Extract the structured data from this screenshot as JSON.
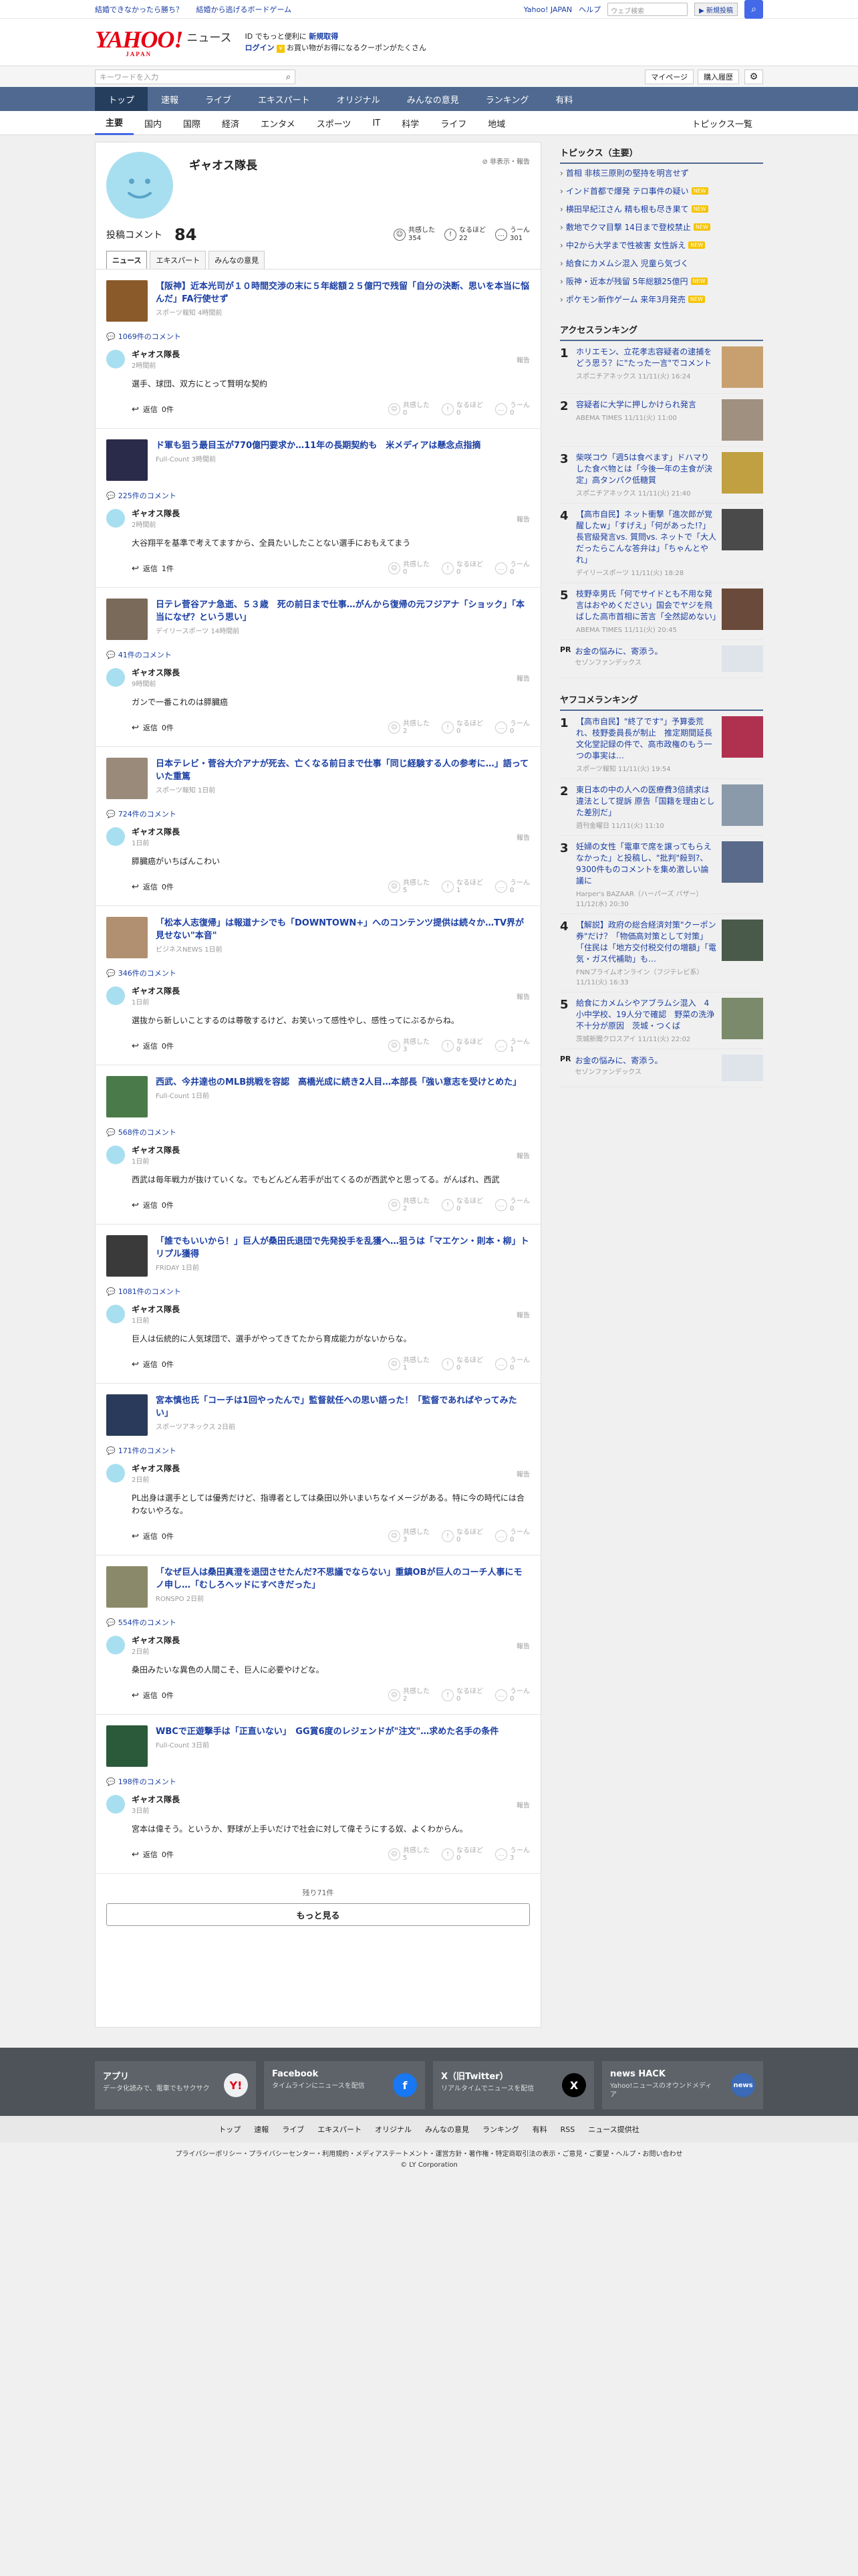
{
  "top_links": [
    "結婚できなかったら勝ち？",
    "結婚から逃げるボードゲーム"
  ],
  "top_right": {
    "yahoo": "Yahoo! JAPAN",
    "help": "ヘルプ",
    "search_placeholder": "ウェブ検索",
    "search_btn": "▶ 新規投稿"
  },
  "logo": {
    "main": "YAHOO!",
    "sub": "JAPAN",
    "news": "ニュース"
  },
  "promo": {
    "line1a": "ID でもっと便利に",
    "line1b": "新規取得",
    "line2a": "ログイン",
    "line2b": "お買い物がお得になるクーポンがたくさん"
  },
  "search": {
    "placeholder": "キーワードを入力",
    "mypage": "マイページ",
    "history": "購入履歴"
  },
  "mainnav": [
    "トップ",
    "速報",
    "ライブ",
    "エキスパート",
    "オリジナル",
    "みんなの意見",
    "ランキング",
    "有料"
  ],
  "subnav": [
    "主要",
    "国内",
    "国際",
    "経済",
    "エンタメ",
    "スポーツ",
    "IT",
    "科学",
    "ライフ",
    "地域"
  ],
  "subnav_all": "トピックス一覧",
  "profile": {
    "name": "ギャオス隊長",
    "hide": "非表示・報告",
    "posts_label": "投稿コメント",
    "posts_count": "84",
    "reactions": [
      {
        "label": "共感した",
        "count": "354"
      },
      {
        "label": "なるほど",
        "count": "22"
      },
      {
        "label": "うーん",
        "count": "301"
      }
    ]
  },
  "tabs": [
    "ニュース",
    "エキスパート",
    "みんなの意見"
  ],
  "reply_label": "返信",
  "vote_labels": [
    "共感した",
    "なるほど",
    "うーん"
  ],
  "report_label": "報告",
  "entries": [
    {
      "title": "【阪神】近本光司が１０時間交渉の末に５年総額２５億円で残留「自分の決断、思いを本当に悩んだ」FA行使せず",
      "source": "スポーツ報知 4時間前",
      "comments": "1069件のコメント",
      "time": "2時間前",
      "text": "選手、球団、双方にとって賢明な契約",
      "replies": "0件",
      "votes": [
        "0",
        "0",
        "0"
      ],
      "thumb": "#8a5a2a"
    },
    {
      "title": "ド軍も狙う最目玉が770億円要求か…11年の長期契約も　米メディアは懸念点指摘",
      "source": "Full-Count 3時間前",
      "comments": "225件のコメント",
      "time": "2時間前",
      "text": "大谷翔平を基準で考えてますから、全員たいしたことない選手におもえてまう",
      "replies": "1件",
      "votes": [
        "0",
        "0",
        "0"
      ],
      "thumb": "#2a2a4a"
    },
    {
      "title": "日テレ菅谷アナ急逝、５３歳　死の前日まで仕事…がんから復帰の元フジアナ「ショック」「本当になぜ？という思い」",
      "source": "デイリースポーツ 14時間前",
      "comments": "41件のコメント",
      "time": "9時間前",
      "text": "ガンで一番これのは膵臓癌",
      "replies": "0件",
      "votes": [
        "2",
        "0",
        "0"
      ],
      "thumb": "#7a6a5a"
    },
    {
      "title": "日本テレビ・菅谷大介アナが死去、亡くなる前日まで仕事「同じ経験する人の参考に…」語っていた重篤",
      "source": "スポーツ報知 1日前",
      "comments": "724件のコメント",
      "time": "1日前",
      "text": "膵臓癌がいちばんこわい",
      "replies": "0件",
      "votes": [
        "5",
        "1",
        "0"
      ],
      "thumb": "#9a8a7a"
    },
    {
      "title": "「松本人志復帰」は報道ナシでも「DOWNTOWN+」へのコンテンツ提供は続々か…TV界が見せない\"本音\"",
      "source": "ビジネスNEWS 1日前",
      "comments": "346件のコメント",
      "time": "1日前",
      "text": "選抜から新しいことするのは尊敬するけど、お笑いって感性やし、感性ってにぶるからね。",
      "replies": "0件",
      "votes": [
        "3",
        "0",
        "1"
      ],
      "thumb": "#b09070"
    },
    {
      "title": "西武、今井達也のMLB挑戦を容認　高橋光成に続き2人目…本部長「強い意志を受けとめた」",
      "source": "Full-Count 1日前",
      "comments": "568件のコメント",
      "time": "1日前",
      "text": "西武は毎年戦力が抜けていくな。でもどんどん若手が出てくるのが西武やと思ってる。がんばれ、西武",
      "replies": "0件",
      "votes": [
        "2",
        "0",
        "0"
      ],
      "thumb": "#4a7a4a"
    },
    {
      "title": "「誰でもいいから！」巨人が桑田氏退団で先発投手を乱獲へ…狙うは「マエケン・則本・柳」トリプル獲得",
      "source": "FRIDAY 1日前",
      "comments": "1081件のコメント",
      "time": "1日前",
      "text": "巨人は伝統的に人気球団で、選手がやってきてたから育成能力がないからな。",
      "replies": "0件",
      "votes": [
        "1",
        "0",
        "0"
      ],
      "thumb": "#3a3a3a"
    },
    {
      "title": "宮本慎也氏「コーチは1回やったんで」監督就任への思い語った！「監督であればやってみたい」",
      "source": "スポーツアネックス 2日前",
      "comments": "171件のコメント",
      "time": "2日前",
      "text": "PL出身は選手としては優秀だけど、指導者としては桑田以外いまいちなイメージがある。特に今の時代には合わないやろな。",
      "replies": "0件",
      "votes": [
        "3",
        "0",
        "0"
      ],
      "thumb": "#2a3a5a"
    },
    {
      "title": "「なぜ巨人は桑田真澄を退団させたんだ?不思議でならない」重鎮OBが巨人のコーチ人事にモノ申し…「むしろヘッドにすべきだった」",
      "source": "RONSPO 2日前",
      "comments": "554件のコメント",
      "time": "2日前",
      "text": "桑田みたいな異色の人間こそ、巨人に必要やけどな。",
      "replies": "0件",
      "votes": [
        "2",
        "0",
        "0"
      ],
      "thumb": "#8a8a6a"
    },
    {
      "title": "WBCで正遊撃手は「正直いない」　GG賞6度のレジェンドが\"注文\"…求めた名手の条件",
      "source": "Full-Count 3日前",
      "comments": "198件のコメント",
      "time": "3日前",
      "text": "宮本は偉そう。というか、野球が上手いだけで社会に対して偉そうにする奴、よくわからん。",
      "replies": "0件",
      "votes": [
        "5",
        "0",
        "3"
      ],
      "thumb": "#2a5a3a"
    }
  ],
  "more": {
    "remain": "残り71件",
    "button": "もっと見る"
  },
  "side": {
    "topics_head": "トピックス（主要）",
    "topics": [
      {
        "t": "首相 非核三原則の堅持を明言せず",
        "n": false
      },
      {
        "t": "インド首都で爆発 テロ事件の疑い",
        "n": true
      },
      {
        "t": "横田早紀江さん 精も根も尽き果て",
        "n": true
      },
      {
        "t": "敷地でクマ目撃 14日まで登校禁止",
        "n": true
      },
      {
        "t": "中2から大学まで性被害 女性訴え",
        "n": true
      },
      {
        "t": "給食にカメムシ混入 児童ら気づく",
        "n": false
      },
      {
        "t": "阪神・近本が残留 5年総額25億円",
        "n": true
      },
      {
        "t": "ポケモン新作ゲーム 来年3月発売",
        "n": true
      }
    ],
    "access_head": "アクセスランキング",
    "access": [
      {
        "n": "1",
        "t": "ホリエモン、立花孝志容疑者の逮捕をどう思う？に\"たった一言\"でコメント",
        "s": "スポニチアネックス 11/11(火) 16:24",
        "c": "#c8a070"
      },
      {
        "n": "2",
        "t": "容疑者に大学に押しかけられ発言",
        "s": "ABEMA TIMES 11/11(火) 11:00",
        "c": "#a09080"
      },
      {
        "n": "3",
        "t": "柴咲コウ「週5は食べます」ドハマりした食べ物とは「今後一年の主食が決定」高タンパク低糖質",
        "s": "スポニチアネックス 11/11(火) 21:40",
        "c": "#c0a040"
      },
      {
        "n": "4",
        "t": "【高市自民】ネット衝撃「進次郎が覚醒したw」「すげえ」「何があった!?」長官級発言vs. 質問vs. ネットで「大人だったらこんな答弁は」「ちゃんとやれ」",
        "s": "デイリースポーツ 11/11(火) 18:28",
        "c": "#4a4a4a"
      },
      {
        "n": "5",
        "t": "枝野幸男氏「何でサイドとも不用な発言はおやめください」国会でヤジを飛ばした高市首相に苦言「全然認めない」",
        "s": "ABEMA TIMES 11/11(火) 20:45",
        "c": "#6a4a3a"
      }
    ],
    "pr": {
      "tag": "PR",
      "t": "お金の悩みに、寄添う。",
      "s": "セゾンファンデックス"
    },
    "yafuko_head": "ヤフコメランキング",
    "yafuko": [
      {
        "n": "1",
        "t": "【高市自民】\"終了です\"」予算委荒れ、枝野委員長が制止　推定期間延長文化堂記録の件で、高市政権のもう一つの事実は…",
        "s": "スポーツ報知 11/11(火) 19:54",
        "c": "#b03050"
      },
      {
        "n": "2",
        "t": "東日本の中の人への医療費3倍請求は違法として提訴 原告「国籍を理由とした差別だ」",
        "s": "週刊金曜日 11/11(火) 11:10",
        "c": "#8a9aaa"
      },
      {
        "n": "3",
        "t": "妊婦の女性「電車で席を譲ってもらえなかった」と投稿し、\"批判\"殺到?、9300件ものコメントを集め激しい論議に",
        "s": "Harper's BAZAAR（ハーパーズ バザー） 11/12(水) 20:30",
        "c": "#5a6a8a"
      },
      {
        "n": "4",
        "t": "【解説】政府の総合経済対策\"クーポン券\"だけ？「物価高対策として対策」「住民は「地方交付税交付の増額」「電気・ガス代補助」も…",
        "s": "FNNプライムオンライン（フジテレビ系） 11/11(火) 16:33",
        "c": "#4a5a4a"
      },
      {
        "n": "5",
        "t": "給食にカメムシやアブラムシ混入　4小中学校、19人分で確認　野菜の洗浄不十分が原因　茨城・つくば",
        "s": "茨城新聞クロスアイ 11/11(火) 22:02",
        "c": "#7a8a6a"
      }
    ]
  },
  "footer": {
    "cards": [
      {
        "h": "アプリ",
        "d": "データ化読みで、電車でもサクサク",
        "lg": "Y!",
        "c": "#eef0f2"
      },
      {
        "h": "Facebook",
        "d": "タイムラインにニュースを配信",
        "lg": "f",
        "c": "#1877f2"
      },
      {
        "h": "X（旧Twitter）",
        "d": "リアルタイムでニュースを配信",
        "lg": "X",
        "c": "#000000"
      },
      {
        "h": "news HACK",
        "d": "Yahoo!ニュースのオウンドメディア",
        "lg": "news",
        "c": "#3a6ab8"
      }
    ],
    "links": [
      "トップ",
      "速報",
      "ライブ",
      "エキスパート",
      "オリジナル",
      "みんなの意見",
      "ランキング",
      "有料",
      "RSS",
      "ニュース提供社"
    ],
    "legal": "プライバシーポリシー・プライバシーセンター・利用規約・メディアステートメント・運営方針・著作権・特定商取引法の表示・ご意見・ご要望・ヘルプ・お問い合わせ",
    "copy": "© LY Corporation"
  }
}
